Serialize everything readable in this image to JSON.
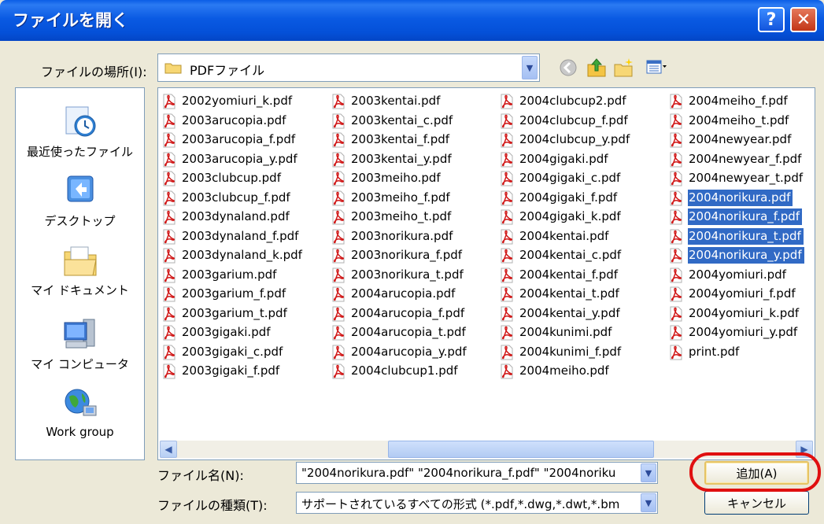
{
  "window": {
    "title": "ファイルを開く",
    "help_label": "?",
    "close_label": "✕"
  },
  "lookin": {
    "label": "ファイルの場所(I):",
    "value": "PDFファイル"
  },
  "places": [
    {
      "label": "最近使ったファイル",
      "icon": "recent-documents-icon"
    },
    {
      "label": "デスクトップ",
      "icon": "desktop-icon"
    },
    {
      "label": "マイ ドキュメント",
      "icon": "my-documents-folder-icon"
    },
    {
      "label": "マイ コンピュータ",
      "icon": "my-computer-icon"
    },
    {
      "label": "Work group",
      "icon": "network-globe-icon"
    }
  ],
  "files": {
    "col1": [
      "2002yomiuri_k.pdf",
      "2003arucopia.pdf",
      "2003arucopia_f.pdf",
      "2003arucopia_y.pdf",
      "2003clubcup.pdf",
      "2003clubcup_f.pdf",
      "2003dynaland.pdf",
      "2003dynaland_f.pdf",
      "2003dynaland_k.pdf",
      "2003garium.pdf",
      "2003garium_f.pdf",
      "2003garium_t.pdf",
      "2003gigaki.pdf",
      "2003gigaki_c.pdf",
      "2003gigaki_f.pdf"
    ],
    "col2": [
      "2003kentai.pdf",
      "2003kentai_c.pdf",
      "2003kentai_f.pdf",
      "2003kentai_y.pdf",
      "2003meiho.pdf",
      "2003meiho_f.pdf",
      "2003meiho_t.pdf",
      "2003norikura.pdf",
      "2003norikura_f.pdf",
      "2003norikura_t.pdf",
      "2004arucopia.pdf",
      "2004arucopia_f.pdf",
      "2004arucopia_t.pdf",
      "2004arucopia_y.pdf",
      "2004clubcup1.pdf"
    ],
    "col3": [
      "2004clubcup2.pdf",
      "2004clubcup_f.pdf",
      "2004clubcup_y.pdf",
      "2004gigaki.pdf",
      "2004gigaki_c.pdf",
      "2004gigaki_f.pdf",
      "2004gigaki_k.pdf",
      "2004kentai.pdf",
      "2004kentai_c.pdf",
      "2004kentai_f.pdf",
      "2004kentai_t.pdf",
      "2004kentai_y.pdf",
      "2004kunimi.pdf",
      "2004kunimi_f.pdf",
      "2004meiho.pdf"
    ],
    "col4": [
      "2004meiho_f.pdf",
      "2004meiho_t.pdf",
      "2004newyear.pdf",
      "2004newyear_f.pdf",
      "2004newyear_t.pdf",
      "2004norikura.pdf",
      "2004norikura_f.pdf",
      "2004norikura_t.pdf",
      "2004norikura_y.pdf",
      "2004yomiuri.pdf",
      "2004yomiuri_f.pdf",
      "2004yomiuri_k.pdf",
      "2004yomiuri_y.pdf",
      "print.pdf"
    ]
  },
  "selected_files": [
    "2004norikura.pdf",
    "2004norikura_f.pdf",
    "2004norikura_t.pdf",
    "2004norikura_y.pdf"
  ],
  "filename": {
    "label": "ファイル名(N):",
    "value": "\"2004norikura.pdf\" \"2004norikura_f.pdf\" \"2004noriku"
  },
  "filetype": {
    "label": "ファイルの種類(T):",
    "value": "サポートされているすべての形式 (*.pdf,*.dwg,*.dwt,*.bm"
  },
  "buttons": {
    "add": "追加(A)",
    "cancel": "キャンセル"
  },
  "colors": {
    "titlebar": "#0a5ae3",
    "selection": "#316ac5",
    "dialog_bg": "#ece9d8",
    "highlight_ring": "#e01010"
  }
}
